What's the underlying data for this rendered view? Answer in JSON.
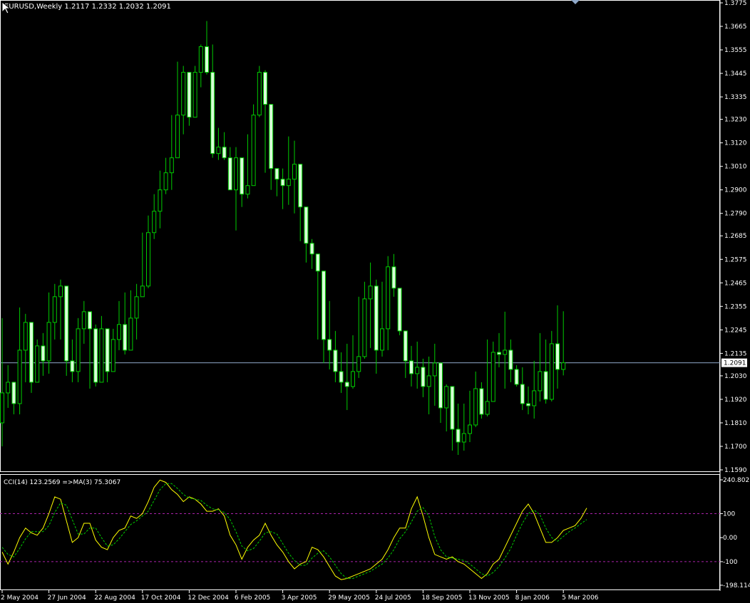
{
  "header": {
    "symbol": "EURUSD,Weekly",
    "open": "1.2117",
    "high": "1.2332",
    "low": "1.2032",
    "close": "1.2091",
    "summary": "EURUSD,Weekly  1.2117 1.2332 1.2032 1.2091"
  },
  "price_axis": {
    "ticks": [
      "1.3775",
      "1.3665",
      "1.3555",
      "1.3445",
      "1.3335",
      "1.3230",
      "1.3120",
      "1.3010",
      "1.2900",
      "1.2790",
      "1.2685",
      "1.2575",
      "1.2465",
      "1.2355",
      "1.2245",
      "1.2135",
      "1.2030",
      "1.1920",
      "1.1810",
      "1.1700",
      "1.1590"
    ],
    "current_price_label": "1.2091"
  },
  "indicator": {
    "label": "CCI(14) 123.2569  =>MA(3) 75.3067",
    "axis_ticks": [
      "240.802",
      "100",
      "0.00",
      "-100",
      "-198.114"
    ]
  },
  "time_axis": {
    "labels": [
      "2 May 2004",
      "27 Jun 2004",
      "22 Aug 2004",
      "17 Oct 2004",
      "12 Dec 2004",
      "6 Feb 2005",
      "3 Apr 2005",
      "29 May 2005",
      "24 Jul 2005",
      "18 Sep 2005",
      "13 Nov 2005",
      "8 Jan 2006",
      "5 Mar 2006"
    ]
  },
  "colors": {
    "background": "#000000",
    "candle_up_fill": "#000000",
    "candle_down_fill": "#d8ffd8",
    "candle_wick": "#00cc00",
    "price_line": "#8fa8c8",
    "cci_line": "#ffff00",
    "ma_line": "#00cc00",
    "level_line": "#aa22aa",
    "frame": "#ffffff"
  },
  "chart_data": [
    {
      "type": "candlestick",
      "title": "EURUSD,Weekly",
      "ylim": [
        1.159,
        1.3775
      ],
      "current_price": 1.2091,
      "x_labels": [
        "2 May 2004",
        "27 Jun 2004",
        "22 Aug 2004",
        "17 Oct 2004",
        "12 Dec 2004",
        "6 Feb 2005",
        "3 Apr 2005",
        "29 May 2005",
        "24 Jul 2005",
        "18 Sep 2005",
        "13 Nov 2005",
        "8 Jan 2006",
        "5 Mar 2006"
      ],
      "close": [
        1.195,
        1.2,
        1.19,
        1.215,
        1.228,
        1.2,
        1.217,
        1.21,
        1.228,
        1.24,
        1.245,
        1.21,
        1.205,
        1.225,
        1.233,
        1.225,
        1.2,
        1.225,
        1.205,
        1.22,
        1.227,
        1.215,
        1.23,
        1.24,
        1.245,
        1.27,
        1.28,
        1.29,
        1.298,
        1.305,
        1.325,
        1.345,
        1.324,
        1.345,
        1.357,
        1.345,
        1.307,
        1.31,
        1.305,
        1.29,
        1.305,
        1.288,
        1.292,
        1.325,
        1.345,
        1.33,
        1.3,
        1.295,
        1.292,
        1.295,
        1.302,
        1.282,
        1.265,
        1.26,
        1.252,
        1.22,
        1.215,
        1.205,
        1.2,
        1.198,
        1.205,
        1.212,
        1.239,
        1.245,
        1.215,
        1.225,
        1.254,
        1.244,
        1.224,
        1.21,
        1.204,
        1.207,
        1.198,
        1.203,
        1.209,
        1.188,
        1.198,
        1.178,
        1.172,
        1.176,
        1.18,
        1.197,
        1.185,
        1.191,
        1.214,
        1.213,
        1.215,
        1.206,
        1.199,
        1.19,
        1.189,
        1.196,
        1.205,
        1.192,
        1.218,
        1.206,
        1.2091
      ],
      "high": [
        1.23,
        1.208,
        1.2,
        1.235,
        1.232,
        1.213,
        1.22,
        1.223,
        1.242,
        1.246,
        1.248,
        1.218,
        1.22,
        1.23,
        1.238,
        1.23,
        1.227,
        1.231,
        1.223,
        1.225,
        1.238,
        1.242,
        1.243,
        1.246,
        1.27,
        1.278,
        1.288,
        1.299,
        1.305,
        1.325,
        1.35,
        1.348,
        1.331,
        1.348,
        1.358,
        1.369,
        1.358,
        1.319,
        1.317,
        1.31,
        1.31,
        1.29,
        1.316,
        1.33,
        1.348,
        1.346,
        1.31,
        1.3,
        1.3,
        1.315,
        1.313,
        1.294,
        1.28,
        1.267,
        1.26,
        1.236,
        1.238,
        1.224,
        1.214,
        1.218,
        1.222,
        1.24,
        1.247,
        1.256,
        1.248,
        1.247,
        1.259,
        1.26,
        1.241,
        1.222,
        1.217,
        1.219,
        1.211,
        1.212,
        1.218,
        1.205,
        1.199,
        1.196,
        1.19,
        1.19,
        1.196,
        1.205,
        1.2,
        1.22,
        1.219,
        1.223,
        1.233,
        1.22,
        1.208,
        1.207,
        1.198,
        1.21,
        1.223,
        1.22,
        1.224,
        1.236,
        1.2332
      ],
      "low": [
        1.17,
        1.188,
        1.185,
        1.185,
        1.2,
        1.195,
        1.2,
        1.203,
        1.204,
        1.22,
        1.22,
        1.203,
        1.2,
        1.2,
        1.218,
        1.197,
        1.198,
        1.202,
        1.2,
        1.206,
        1.215,
        1.213,
        1.215,
        1.22,
        1.242,
        1.244,
        1.267,
        1.272,
        1.288,
        1.29,
        1.305,
        1.316,
        1.32,
        1.324,
        1.338,
        1.344,
        1.305,
        1.304,
        1.304,
        1.29,
        1.271,
        1.282,
        1.286,
        1.3,
        1.324,
        1.298,
        1.29,
        1.287,
        1.281,
        1.283,
        1.279,
        1.266,
        1.256,
        1.253,
        1.22,
        1.209,
        1.206,
        1.2,
        1.195,
        1.187,
        1.197,
        1.202,
        1.211,
        1.216,
        1.204,
        1.212,
        1.215,
        1.24,
        1.222,
        1.202,
        1.198,
        1.197,
        1.193,
        1.185,
        1.189,
        1.181,
        1.177,
        1.168,
        1.166,
        1.168,
        1.172,
        1.179,
        1.183,
        1.184,
        1.193,
        1.207,
        1.197,
        1.2,
        1.198,
        1.187,
        1.185,
        1.183,
        1.191,
        1.19,
        1.191,
        1.197,
        1.2032
      ],
      "open_first": 1.181
    },
    {
      "type": "line",
      "title": "CCI(14) 123.2569  =>MA(3) 75.3067",
      "ylim": [
        -198.114,
        240.802
      ],
      "levels": [
        100,
        -100
      ],
      "series": [
        {
          "name": "CCI(14)",
          "values": [
            -60,
            -110,
            -60,
            0,
            40,
            20,
            10,
            40,
            100,
            170,
            160,
            70,
            -20,
            0,
            60,
            60,
            -10,
            -40,
            -50,
            0,
            30,
            40,
            90,
            80,
            100,
            150,
            210,
            240,
            230,
            200,
            180,
            150,
            170,
            160,
            140,
            110,
            110,
            120,
            90,
            10,
            -30,
            -90,
            -40,
            -10,
            10,
            60,
            10,
            -30,
            -60,
            -100,
            -130,
            -110,
            -100,
            -40,
            -50,
            -80,
            -120,
            -160,
            -175,
            -170,
            -160,
            -150,
            -140,
            -130,
            -110,
            -90,
            -50,
            0,
            40,
            40,
            120,
            170,
            90,
            0,
            -70,
            -80,
            -90,
            -80,
            -100,
            -110,
            -130,
            -150,
            -170,
            -150,
            -110,
            -90,
            -40,
            10,
            60,
            110,
            140,
            100,
            40,
            -20,
            -20,
            0,
            30,
            40,
            50,
            80,
            123.2569
          ],
          "color": "#ffff00"
        },
        {
          "name": "MA(3)",
          "values": [
            -40,
            -70,
            -80,
            -45,
            -5,
            25,
            25,
            25,
            50,
            105,
            145,
            135,
            75,
            15,
            15,
            40,
            40,
            0,
            -35,
            -30,
            -5,
            25,
            55,
            70,
            90,
            110,
            155,
            200,
            225,
            225,
            205,
            180,
            165,
            160,
            155,
            135,
            120,
            115,
            105,
            75,
            25,
            -35,
            -55,
            -45,
            -15,
            20,
            25,
            15,
            -25,
            -65,
            -95,
            -115,
            -115,
            -85,
            -65,
            -55,
            -80,
            -115,
            -150,
            -170,
            -170,
            -160,
            -150,
            -140,
            -125,
            -110,
            -85,
            -50,
            -5,
            25,
            65,
            110,
            125,
            90,
            5,
            -50,
            -80,
            -85,
            -90,
            -95,
            -110,
            -130,
            -150,
            -160,
            -145,
            -120,
            -85,
            -45,
            10,
            60,
            100,
            115,
            95,
            40,
            0,
            -15,
            5,
            25,
            40,
            58,
            75.3067
          ],
          "color": "#00cc00"
        }
      ]
    }
  ]
}
